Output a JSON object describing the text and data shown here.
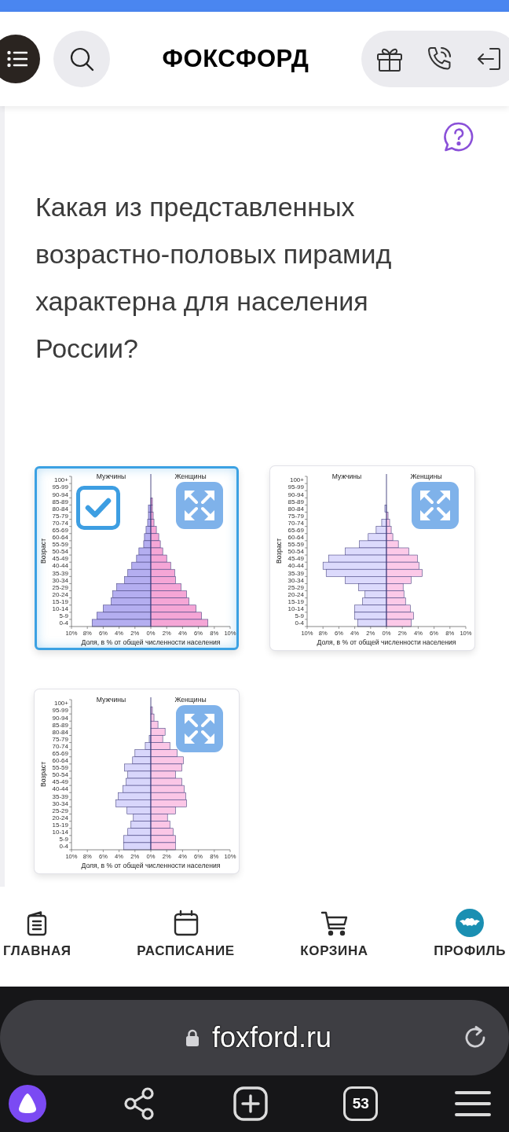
{
  "header": {
    "logo": "ФОКСФОРД"
  },
  "question": {
    "text": "Какая из представленных возрастно-половых пирамид характерна для населения России?"
  },
  "options": [
    {
      "selected": true,
      "chart_data": {
        "type": "bar",
        "orientation": "horizontal",
        "stacked": true,
        "xlabel": "Доля, в % от общей численности населения",
        "ylabel": "Возраст",
        "xlim": [
          -10,
          10
        ],
        "xticks": [
          {
            "value": -10,
            "label": "10%"
          },
          {
            "value": -8,
            "label": "8%"
          },
          {
            "value": -6,
            "label": "6%"
          },
          {
            "value": -4,
            "label": "4%"
          },
          {
            "value": -2,
            "label": "2%"
          },
          {
            "value": 0,
            "label": "0%"
          },
          {
            "value": 2,
            "label": "2%"
          },
          {
            "value": 4,
            "label": "4%"
          },
          {
            "value": 6,
            "label": "6%"
          },
          {
            "value": 8,
            "label": "8%"
          },
          {
            "value": 10,
            "label": "10%"
          }
        ],
        "categories": [
          "100+",
          "95-99",
          "90-94",
          "85-89",
          "80-84",
          "75-79",
          "70-74",
          "65-69",
          "60-64",
          "55-59",
          "50-54",
          "45-49",
          "40-44",
          "35-39",
          "30-34",
          "25-29",
          "20-24",
          "15-19",
          "10-14",
          "5-9",
          "0-4"
        ],
        "series": [
          {
            "color": "#b4aef0",
            "values": [
              0,
              0,
              0,
              0,
              -0.3,
              -0.3,
              -0.4,
              -0.6,
              -0.8,
              -0.9,
              -1.5,
              -1.8,
              -2.4,
              -2.9,
              -3.3,
              -4.3,
              -4.8,
              -5.0,
              -6.0,
              -6.8,
              -7.4
            ]
          },
          {
            "color": "#f5a6d6",
            "values": [
              0,
              0,
              0,
              0.2,
              0.2,
              0.3,
              0.4,
              0.7,
              1.0,
              1.2,
              1.5,
              2.0,
              2.5,
              3.0,
              3.1,
              3.8,
              4.5,
              4.8,
              5.7,
              6.4,
              7.2
            ]
          }
        ],
        "ref_lines": [
          {
            "axis": "x",
            "value": 0
          }
        ],
        "annotations": [
          "Мужчины",
          "Женщины"
        ]
      }
    },
    {
      "selected": false,
      "chart_data": {
        "type": "bar",
        "orientation": "horizontal",
        "stacked": true,
        "xlabel": "Доля, в % от общей численности населения",
        "ylabel": "Возраст",
        "xlim": [
          -10,
          10
        ],
        "xticks": [
          {
            "value": -10,
            "label": "10%"
          },
          {
            "value": -8,
            "label": "8%"
          },
          {
            "value": -6,
            "label": "6%"
          },
          {
            "value": -4,
            "label": "4%"
          },
          {
            "value": -2,
            "label": "2%"
          },
          {
            "value": 0,
            "label": "0%"
          },
          {
            "value": 2,
            "label": "2%"
          },
          {
            "value": 4,
            "label": "4%"
          },
          {
            "value": 6,
            "label": "6%"
          },
          {
            "value": 8,
            "label": "8%"
          },
          {
            "value": 10,
            "label": "10%"
          }
        ],
        "categories": [
          "100+",
          "95-99",
          "90-94",
          "85-89",
          "80-84",
          "75-79",
          "70-74",
          "65-69",
          "60-64",
          "55-59",
          "50-54",
          "45-49",
          "40-44",
          "35-39",
          "30-34",
          "25-29",
          "20-24",
          "15-19",
          "10-14",
          "5-9",
          "0-4"
        ],
        "series": [
          {
            "color": "#dcdafc",
            "values": [
              0,
              0,
              0,
              0,
              -0.2,
              0,
              -0.6,
              -1.3,
              -2.3,
              -3.4,
              -5.2,
              -7.3,
              -8.0,
              -7.6,
              -5.2,
              -3.5,
              -2.7,
              -3.0,
              -4.0,
              -4.0,
              -3.6
            ]
          },
          {
            "color": "#fcc9e8",
            "values": [
              0,
              0,
              0,
              0,
              0,
              0.2,
              0.4,
              0.6,
              0.8,
              1.5,
              2.8,
              3.9,
              4.1,
              4.5,
              3.1,
              2.1,
              2.2,
              2.4,
              3.0,
              3.4,
              3.1
            ]
          }
        ],
        "ref_lines": [
          {
            "axis": "x",
            "value": 0
          }
        ],
        "annotations": [
          "Мужчины",
          "Женщины"
        ]
      }
    },
    {
      "selected": false,
      "chart_data": {
        "type": "bar",
        "orientation": "horizontal",
        "stacked": true,
        "xlabel": "Доля, в % от общей численности населения",
        "ylabel": "Возраст",
        "xlim": [
          -10,
          10
        ],
        "xticks": [
          {
            "value": -10,
            "label": "10%"
          },
          {
            "value": -8,
            "label": "8%"
          },
          {
            "value": -6,
            "label": "6%"
          },
          {
            "value": -4,
            "label": "4%"
          },
          {
            "value": -2,
            "label": "2%"
          },
          {
            "value": 0,
            "label": "0%"
          },
          {
            "value": 2,
            "label": "2%"
          },
          {
            "value": 4,
            "label": "4%"
          },
          {
            "value": 6,
            "label": "6%"
          },
          {
            "value": 8,
            "label": "8%"
          },
          {
            "value": 10,
            "label": "10%"
          }
        ],
        "categories": [
          "100+",
          "95-99",
          "90-94",
          "85-89",
          "80-84",
          "75-79",
          "70-74",
          "65-69",
          "60-64",
          "55-59",
          "50-54",
          "45-49",
          "40-44",
          "35-39",
          "30-34",
          "25-29",
          "20-24",
          "15-19",
          "10-14",
          "5-9",
          "0-4"
        ],
        "series": [
          {
            "color": "#d8d6fb",
            "values": [
              0,
              0,
              0,
              0,
              0,
              -0.2,
              -0.7,
              -2.0,
              -2.3,
              -3.3,
              -2.9,
              -3.1,
              -3.5,
              -4.1,
              -4.4,
              -3.0,
              -2.2,
              -2.5,
              -2.9,
              -3.4,
              -3.4
            ]
          },
          {
            "color": "#fbc6e6",
            "values": [
              0,
              0.2,
              0.4,
              0.9,
              1.8,
              1.5,
              2.4,
              3.3,
              4.1,
              3.9,
              3.1,
              3.9,
              4.2,
              4.4,
              4.5,
              3.1,
              2.1,
              2.4,
              2.8,
              3.1,
              3.1
            ]
          }
        ],
        "ref_lines": [
          {
            "axis": "x",
            "value": 0
          }
        ],
        "annotations": [
          "Мужчины",
          "Женщины"
        ]
      }
    }
  ],
  "bottom_nav": {
    "items": [
      {
        "label": "ГЛАВНАЯ",
        "kind": "home"
      },
      {
        "label": "РАСПИСАНИЕ",
        "kind": "schedule"
      },
      {
        "label": "КОРЗИНА",
        "kind": "cart"
      },
      {
        "label": "ПРОФИЛЬ",
        "kind": "profile"
      }
    ]
  },
  "browser": {
    "url": "foxford.ru",
    "tab_count": "53"
  }
}
